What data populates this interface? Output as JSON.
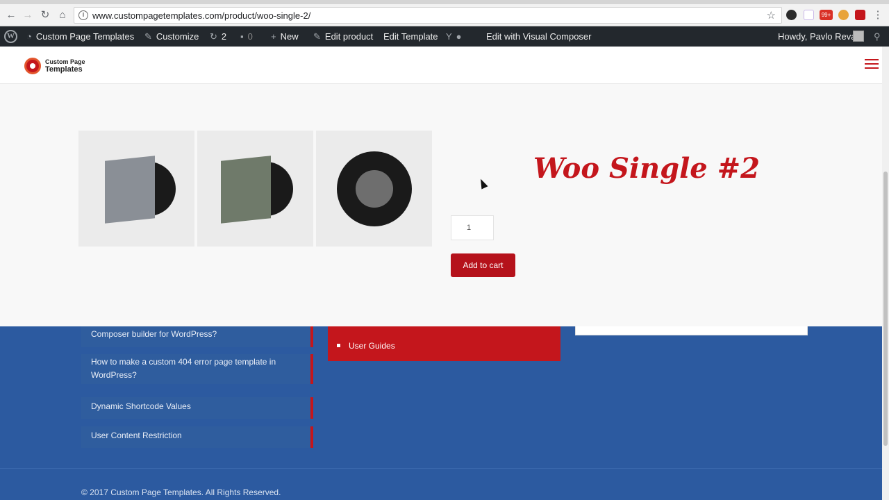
{
  "browser": {
    "url": "www.custompagetemplates.com/product/woo-single-2/",
    "back_icon": "←",
    "forward_icon": "→",
    "reload_icon": "↻",
    "home_icon": "⌂",
    "star_icon": "☆",
    "info_icon": "i",
    "menu_icon": "⋮",
    "badge": "99+"
  },
  "adminbar": {
    "site_name": "Custom Page Templates",
    "customize": "Customize",
    "updates_count": "2",
    "comments_count": "0",
    "new": "New",
    "edit_product": "Edit product",
    "edit_template": "Edit Template",
    "edit_visual": "Edit with Visual Composer",
    "howdy": "Howdy, Pavlo Reva",
    "wp_glyph": "W",
    "seo_glyph": "Y",
    "search_icon": "⚲"
  },
  "header": {
    "logo_line1": "Custom Page",
    "logo_line2": "Templates"
  },
  "product": {
    "title": "Woo Single #2",
    "quantity": "1",
    "add_to_cart": "Add to cart"
  },
  "footer": {
    "list": [
      "Composer builder for WordPress?",
      "How to make a custom 404 error page template in WordPress?",
      "Dynamic Shortcode Values",
      "User Content Restriction"
    ],
    "red_item": "User Guides",
    "copyright": "© 2017 Custom Page Templates. All Rights Reserved."
  },
  "colors": {
    "accent": "#c4161c",
    "footer_bg": "#2c5aa0",
    "adminbar_bg": "#23282d"
  }
}
